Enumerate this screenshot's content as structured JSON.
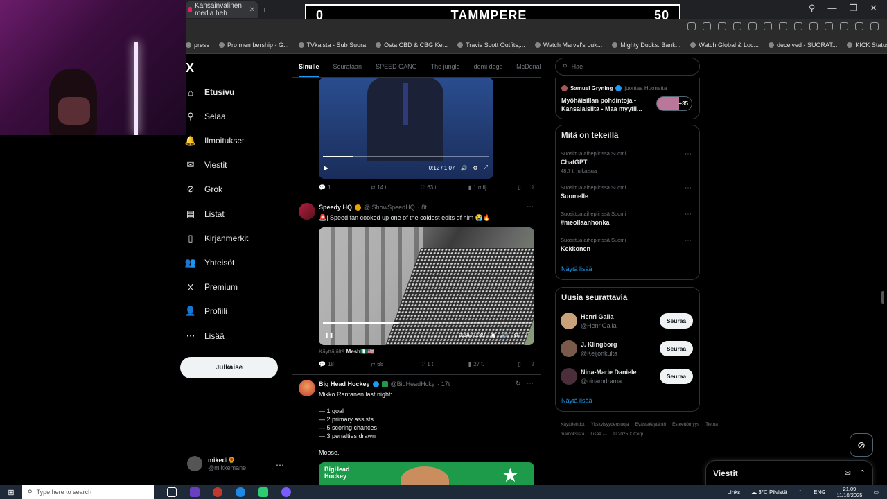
{
  "browser": {
    "tab_title": "Kansainvälinen media heh",
    "new_tab": "+",
    "bookmarks": [
      "press",
      "Pro membership - G...",
      "TVkaista - Sub Suora",
      "Osta CBD & CBG Ke...",
      "Travis Scott Outfits,...",
      "Watch Marvel's Luk...",
      "Mighty Ducks: Bank...",
      "Watch Global & Loc...",
      "deceived - SUORAT...",
      "KICK Status Page"
    ]
  },
  "scoreboard": {
    "left": "0",
    "center": "TAMMPERE",
    "right": "50"
  },
  "sidebar": {
    "logo": "X",
    "items": [
      {
        "label": "Etusivu",
        "icon": "home-icon",
        "glyph": "⌂"
      },
      {
        "label": "Selaa",
        "icon": "search-icon",
        "glyph": "⚲"
      },
      {
        "label": "Ilmoitukset",
        "icon": "bell-icon",
        "glyph": "🔔"
      },
      {
        "label": "Viestit",
        "icon": "mail-icon",
        "glyph": "✉"
      },
      {
        "label": "Grok",
        "icon": "grok-icon",
        "glyph": "⊘"
      },
      {
        "label": "Listat",
        "icon": "list-icon",
        "glyph": "▤"
      },
      {
        "label": "Kirjanmerkit",
        "icon": "bookmark-icon",
        "glyph": "▯"
      },
      {
        "label": "Yhteisöt",
        "icon": "communities-icon",
        "glyph": "👥"
      },
      {
        "label": "Premium",
        "icon": "x-premium-icon",
        "glyph": "X"
      },
      {
        "label": "Profiili",
        "icon": "profile-icon",
        "glyph": "👤"
      },
      {
        "label": "Lisää",
        "icon": "more-icon",
        "glyph": "⋯"
      }
    ],
    "post_button": "Julkaise",
    "user": {
      "name": "mikedi🌻",
      "handle": "@mikkemane",
      "more": "⋯"
    }
  },
  "feed": {
    "tabs": [
      "Sinulle",
      "Seurataan",
      "SPEED GANG",
      "The jungle",
      "demi dogs",
      "McDonal"
    ],
    "video1": {
      "time": "0:12 / 1:07",
      "progress": 0.18
    },
    "tweet1_actions": {
      "replies": "1 t.",
      "retweets": "14 t.",
      "likes": "63 t.",
      "views": "1 milj."
    },
    "tweet2": {
      "name": "Speedy HQ",
      "handle": "@IShowSpeedHQ",
      "time": "· 8t",
      "text": "🚨| Speed fan cooked up one of the coldest edits of him 😭🔥",
      "video_time": "0:14 / 0:39",
      "progress": 0.36,
      "attribution_prefix": "Käyttäjältä",
      "attribution_name": "Mesh🇳🇬🇺🇸",
      "replies": "18",
      "retweets": "68",
      "likes": "1 t.",
      "views": "27 t."
    },
    "tweet3": {
      "name": "Big Head Hockey",
      "handle": "@BigHeadHcky",
      "time": "· 17t",
      "lines": [
        "Mikko Rantanen last night:",
        "",
        "— 1 goal",
        "— 2 primary assists",
        "— 5 scoring chances",
        "— 3 penalties drawn",
        "",
        "Moose."
      ],
      "media_label_1": "BigHead",
      "media_label_2": "Hockey"
    }
  },
  "right": {
    "search_placeholder": "Hae",
    "space": {
      "host": "Samuel Gryning",
      "status": "juontaa Huonetta",
      "title": "Myöhäisillan pohdintoja - Kansalaisilta - Maa myytii...",
      "count": "+35"
    },
    "trends_title": "Mitä on tekeillä",
    "trends": [
      {
        "context": "Suosittua aihepiirissä Suomi",
        "name": "ChatGPT",
        "posts": "48,7 t. julkaisua"
      },
      {
        "context": "Suosittua aihepiirissä Suomi",
        "name": "Suomelle",
        "posts": ""
      },
      {
        "context": "Suosittua aihepiirissä Suomi",
        "name": "#meollaanhonka",
        "posts": ""
      },
      {
        "context": "Suosittua aihepiirissä Suomi",
        "name": "Kekkonen",
        "posts": ""
      }
    ],
    "show_more": "Näytä lisää",
    "follow_title": "Uusia seurattavia",
    "follow": [
      {
        "name": "Henri Galla",
        "handle": "@HenriGalla",
        "button": "Seuraa"
      },
      {
        "name": "J. Klingborg",
        "handle": "@Keijonkulta",
        "button": "Seuraa"
      },
      {
        "name": "Nina-Marie Daniele",
        "handle": "@ninamdrama",
        "button": "Seuraa"
      }
    ],
    "footer": [
      "Käyttöehdot",
      "Yksityisyydensuoja",
      "Evästekäytäntö",
      "Esteettömyys",
      "Tietoa mainoksista",
      "Lisää ···",
      "© 2025 X Corp."
    ],
    "messages_title": "Viestit"
  },
  "taskbar": {
    "search_placeholder": "Type here to search",
    "links": "Links",
    "weather": "3°C  Pilvistä",
    "lang": "ENG",
    "time": "21.09",
    "date": "11/10/2025"
  },
  "colors": {
    "accent": "#1d9bf0",
    "border": "#2f3336",
    "muted": "#71767b"
  }
}
